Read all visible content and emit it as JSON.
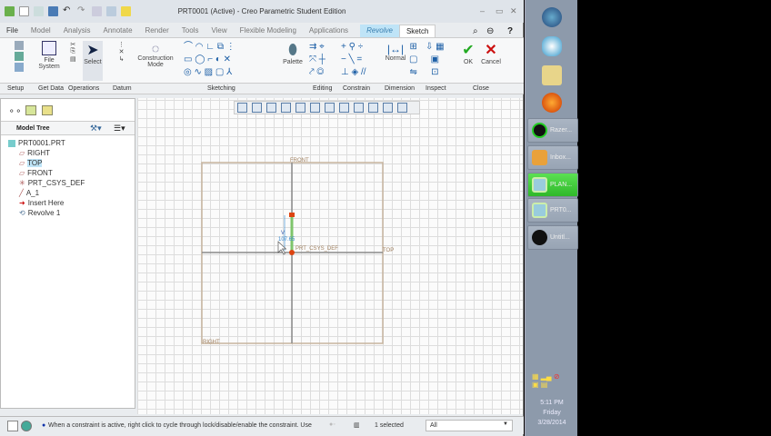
{
  "window": {
    "title": "PRT0001 (Active) - Creo Parametric Student Edition"
  },
  "tabs": [
    "File",
    "Model",
    "Analysis",
    "Annotate",
    "Render",
    "Tools",
    "View",
    "Flexible Modeling",
    "Applications",
    "Revolve",
    "Sketch"
  ],
  "ribbon": {
    "file_system": "File System",
    "select": "Select",
    "construction_mode": "Construction Mode",
    "palette": "Palette",
    "normal": "Normal",
    "ok": "OK",
    "cancel": "Cancel"
  },
  "groups": [
    "Setup",
    "Get Data",
    "Operations",
    "Datum",
    "Sketching",
    "Editing",
    "Constrain",
    "Dimension",
    "Inspect",
    "Close"
  ],
  "model_tree": {
    "title": "Model Tree",
    "items": [
      "PRT0001.PRT",
      "RIGHT",
      "TOP",
      "FRONT",
      "PRT_CSYS_DEF",
      "A_1",
      "Insert Here",
      "Revolve 1"
    ]
  },
  "sketch": {
    "front": "FRONT",
    "top": "TOP",
    "right": "RIGHT",
    "csys": "PRT_CSYS_DEF",
    "constraint": "V",
    "dimension": "107.65"
  },
  "status": {
    "message": "When a constraint is active, right click to cycle through lock/disable/enable the constraint. Use",
    "selected": "1 selected",
    "filter": "All"
  },
  "taskbar": {
    "tasks": [
      "Razer...",
      "Inbox...",
      "PLAN...",
      "PRT0...",
      "Untitl..."
    ],
    "time": "5:11 PM",
    "day": "Friday",
    "date": "3/28/2014",
    "active_color": "#3fd43a"
  }
}
